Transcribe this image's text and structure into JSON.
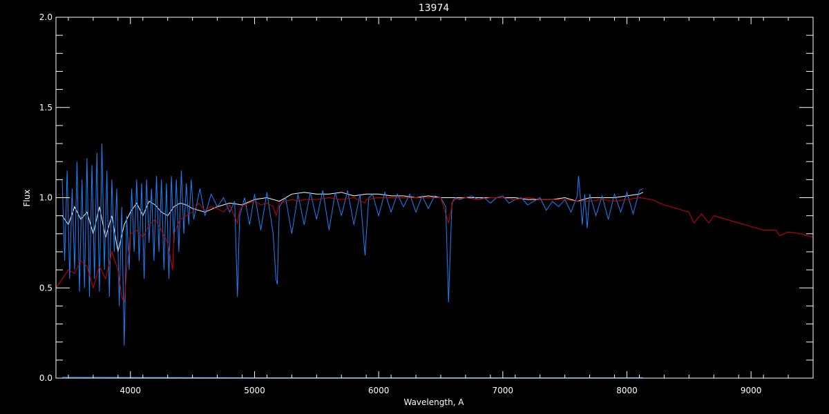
{
  "chart_data": {
    "type": "line",
    "title": "13974",
    "xlabel": "Wavelength, A",
    "ylabel": "Flux",
    "xlim": [
      3400,
      9500
    ],
    "ylim": [
      0,
      2.0
    ],
    "x_ticks": [
      4000,
      5000,
      6000,
      7000,
      8000,
      9000
    ],
    "x_tick_labels": [
      "4000",
      "5000",
      "6000",
      "7000",
      "8000",
      "9000"
    ],
    "y_ticks": [
      0,
      0.5,
      1.0,
      1.5,
      2.0
    ],
    "y_tick_labels": [
      "0.0",
      "0.5",
      "1.0",
      "1.5",
      "2.0"
    ],
    "grid": false,
    "legend": "none",
    "background": "#000000",
    "axis_color": "#ffffff",
    "series": [
      {
        "color": "#ffffff",
        "x": [
          3450,
          3500,
          3550,
          3600,
          3650,
          3700,
          3750,
          3800,
          3850,
          3900,
          3950,
          4000,
          4050,
          4100,
          4150,
          4200,
          4250,
          4300,
          4350,
          4400,
          4450,
          4500,
          4600,
          4700,
          4800,
          4900,
          5000,
          5100,
          5200,
          5300,
          5400,
          5500,
          5600,
          5700,
          5800,
          5900,
          6000,
          6100,
          6200,
          6300,
          6400,
          6500,
          6600,
          6700,
          6800,
          6900,
          7000,
          7100,
          7200,
          7300,
          7400,
          7500,
          7600,
          7700,
          7800,
          7900,
          8000,
          8100,
          8130
        ],
        "y": [
          0.9,
          0.85,
          0.95,
          0.88,
          0.92,
          0.8,
          0.95,
          0.78,
          0.9,
          0.7,
          0.85,
          0.92,
          0.97,
          0.9,
          0.98,
          0.96,
          0.92,
          0.9,
          0.95,
          0.97,
          0.96,
          0.94,
          0.92,
          0.95,
          0.97,
          0.96,
          0.99,
          1.0,
          0.98,
          1.02,
          1.03,
          1.02,
          1.02,
          1.03,
          1.01,
          1.02,
          1.02,
          1.01,
          1.01,
          1.0,
          1.01,
          1.0,
          1.0,
          1.0,
          1.0,
          1.0,
          1.0,
          1.0,
          0.99,
          0.99,
          0.99,
          1.0,
          0.98,
          1.0,
          1.0,
          1.0,
          1.01,
          1.02,
          1.03
        ]
      },
      {
        "color": "#1b84ff",
        "x": [
          3450,
          3470,
          3490,
          3510,
          3530,
          3550,
          3570,
          3590,
          3610,
          3630,
          3650,
          3670,
          3690,
          3710,
          3730,
          3750,
          3770,
          3790,
          3810,
          3830,
          3850,
          3870,
          3890,
          3910,
          3930,
          3950,
          3970,
          3990,
          4010,
          4030,
          4050,
          4070,
          4090,
          4110,
          4130,
          4150,
          4170,
          4190,
          4210,
          4230,
          4250,
          4270,
          4290,
          4310,
          4330,
          4350,
          4370,
          4390,
          4410,
          4430,
          4450,
          4470,
          4490,
          4510,
          4560,
          4600,
          4650,
          4700,
          4750,
          4800,
          4840,
          4862,
          4880,
          4920,
          4960,
          5000,
          5050,
          5100,
          5150,
          5172,
          5183,
          5200,
          5250,
          5300,
          5350,
          5400,
          5450,
          5500,
          5550,
          5600,
          5650,
          5700,
          5750,
          5800,
          5850,
          5890,
          5896,
          5920,
          5950,
          6000,
          6050,
          6100,
          6150,
          6200,
          6250,
          6300,
          6350,
          6400,
          6450,
          6500,
          6540,
          6563,
          6590,
          6620,
          6650,
          6700,
          6750,
          6800,
          6850,
          6900,
          6950,
          7000,
          7050,
          7100,
          7150,
          7200,
          7250,
          7300,
          7350,
          7400,
          7450,
          7500,
          7550,
          7600,
          7610,
          7620,
          7640,
          7660,
          7680,
          7700,
          7750,
          7800,
          7850,
          7900,
          7950,
          8000,
          8050,
          8100,
          8130
        ],
        "y": [
          1.1,
          0.65,
          1.15,
          0.55,
          1.05,
          0.6,
          1.2,
          0.48,
          1.1,
          0.5,
          1.22,
          0.45,
          1.18,
          0.55,
          1.25,
          0.48,
          1.3,
          0.6,
          1.15,
          0.45,
          1.1,
          0.7,
          1.05,
          0.4,
          0.95,
          0.18,
          0.9,
          0.6,
          1.05,
          0.7,
          1.1,
          0.65,
          1.08,
          0.55,
          1.1,
          0.75,
          1.05,
          0.65,
          1.12,
          0.7,
          1.1,
          0.6,
          1.08,
          0.55,
          1.12,
          0.75,
          1.1,
          0.7,
          1.15,
          0.8,
          1.08,
          0.85,
          1.1,
          0.88,
          1.05,
          0.9,
          1.02,
          0.95,
          1.0,
          0.92,
          0.98,
          0.45,
          0.9,
          1.0,
          0.85,
          1.02,
          0.82,
          1.03,
          0.8,
          0.55,
          0.52,
          0.95,
          1.0,
          0.8,
          1.02,
          0.85,
          1.03,
          0.88,
          1.04,
          0.82,
          1.03,
          0.9,
          1.04,
          0.85,
          1.02,
          0.68,
          0.75,
          1.0,
          1.02,
          0.9,
          1.03,
          0.92,
          1.02,
          0.95,
          1.02,
          0.92,
          1.01,
          0.94,
          1.01,
          1.0,
          0.95,
          0.42,
          0.97,
          1.0,
          0.99,
          1.0,
          1.01,
          0.99,
          1.0,
          0.97,
          1.0,
          1.01,
          0.97,
          0.99,
          1.0,
          0.96,
          0.98,
          1.0,
          0.93,
          0.98,
          0.95,
          0.99,
          0.92,
          1.01,
          1.12,
          1.05,
          0.85,
          1.02,
          0.83,
          1.02,
          0.9,
          1.01,
          0.88,
          1.02,
          0.92,
          1.03,
          0.91,
          1.04,
          1.05
        ]
      },
      {
        "color": "#d40000",
        "x": [
          3400,
          3450,
          3500,
          3550,
          3600,
          3650,
          3700,
          3750,
          3800,
          3850,
          3900,
          3930,
          3950,
          3970,
          4000,
          4050,
          4100,
          4150,
          4200,
          4250,
          4300,
          4340,
          4350,
          4400,
          4450,
          4500,
          4550,
          4600,
          4650,
          4700,
          4750,
          4800,
          4861,
          4880,
          4900,
          4950,
          5000,
          5050,
          5100,
          5150,
          5175,
          5200,
          5250,
          5300,
          5350,
          5400,
          5500,
          5600,
          5700,
          5800,
          5890,
          5900,
          6000,
          6100,
          6200,
          6300,
          6400,
          6500,
          6563,
          6600,
          6700,
          6800,
          6900,
          7000,
          7100,
          7200,
          7300,
          7400,
          7500,
          7600,
          7700,
          7800,
          7900,
          8000,
          8100,
          8200,
          8300,
          8400,
          8500,
          8540,
          8600,
          8660,
          8700,
          8800,
          8900,
          9000,
          9100,
          9200,
          9230,
          9300,
          9400,
          9500
        ],
        "y": [
          0.5,
          0.55,
          0.6,
          0.58,
          0.65,
          0.62,
          0.5,
          0.62,
          0.55,
          0.7,
          0.6,
          0.45,
          0.42,
          0.6,
          0.8,
          0.82,
          0.78,
          0.85,
          0.88,
          0.82,
          0.75,
          0.6,
          0.8,
          0.88,
          0.9,
          0.92,
          0.97,
          0.93,
          0.95,
          0.94,
          0.92,
          0.96,
          0.86,
          0.93,
          0.95,
          0.97,
          0.98,
          0.96,
          0.97,
          0.95,
          0.9,
          0.97,
          0.98,
          0.99,
          0.98,
          0.99,
          0.99,
          1.0,
          0.99,
          1.0,
          0.97,
          0.99,
          1.0,
          1.0,
          1.0,
          1.0,
          1.0,
          1.0,
          0.86,
          0.99,
          1.0,
          0.99,
          1.0,
          1.0,
          0.99,
          1.0,
          0.99,
          0.99,
          0.99,
          0.98,
          0.98,
          0.99,
          0.98,
          0.99,
          1.0,
          0.99,
          0.96,
          0.94,
          0.92,
          0.86,
          0.91,
          0.86,
          0.9,
          0.88,
          0.86,
          0.84,
          0.82,
          0.82,
          0.79,
          0.81,
          0.8,
          0.78
        ]
      },
      {
        "color": "#1b84ff",
        "x": [
          3450,
          4000,
          5000,
          6000,
          7000,
          8000,
          8130
        ],
        "y": [
          0.005,
          0.004,
          0.002,
          0.002,
          0.002,
          0.002,
          0.003
        ]
      }
    ]
  }
}
